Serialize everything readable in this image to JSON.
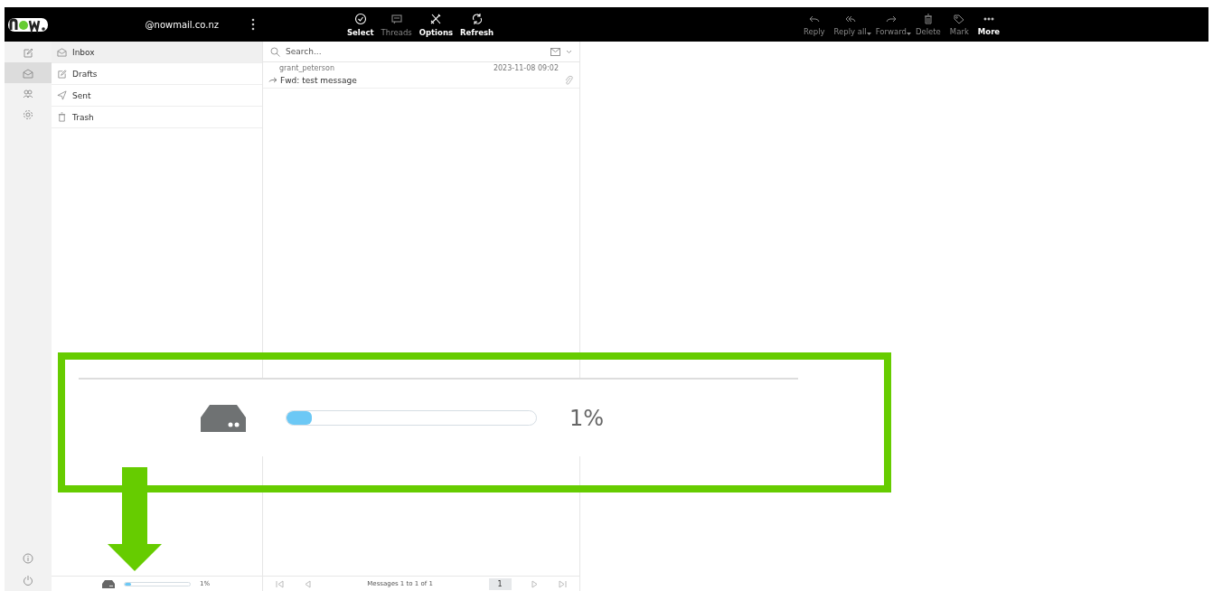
{
  "header": {
    "account": "@nowmail.co.nz",
    "toolbar": [
      {
        "label": "Select",
        "disabled": false
      },
      {
        "label": "Threads",
        "disabled": true
      },
      {
        "label": "Options",
        "disabled": false
      },
      {
        "label": "Refresh",
        "disabled": false
      }
    ],
    "actions": [
      {
        "label": "Reply",
        "disabled": true,
        "has_menu": false
      },
      {
        "label": "Reply all",
        "disabled": true,
        "has_menu": true
      },
      {
        "label": "Forward",
        "disabled": true,
        "has_menu": true
      },
      {
        "label": "Delete",
        "disabled": true,
        "has_menu": false
      },
      {
        "label": "Mark",
        "disabled": true,
        "has_menu": false
      },
      {
        "label": "More",
        "disabled": false,
        "has_menu": false
      }
    ]
  },
  "rail": [
    {
      "selected": false
    },
    {
      "selected": true
    },
    {
      "selected": false
    },
    {
      "selected": false
    }
  ],
  "folders": [
    {
      "label": "Inbox",
      "selected": true
    },
    {
      "label": "Drafts",
      "selected": false
    },
    {
      "label": "Sent",
      "selected": false
    },
    {
      "label": "Trash",
      "selected": false
    }
  ],
  "search": {
    "placeholder": "Search..."
  },
  "messages": [
    {
      "sender": "grant_peterson",
      "date": "2023-11-08 09:02",
      "subject": "Fwd: test message",
      "forwarded": true,
      "attachment": true
    }
  ],
  "quota": {
    "level": 0.1,
    "reading": "1%"
  },
  "pagination": {
    "summary": "Messages 1 to 1 of 1",
    "page": "1"
  },
  "callout": {
    "level": 0.1,
    "reading": "1%"
  }
}
